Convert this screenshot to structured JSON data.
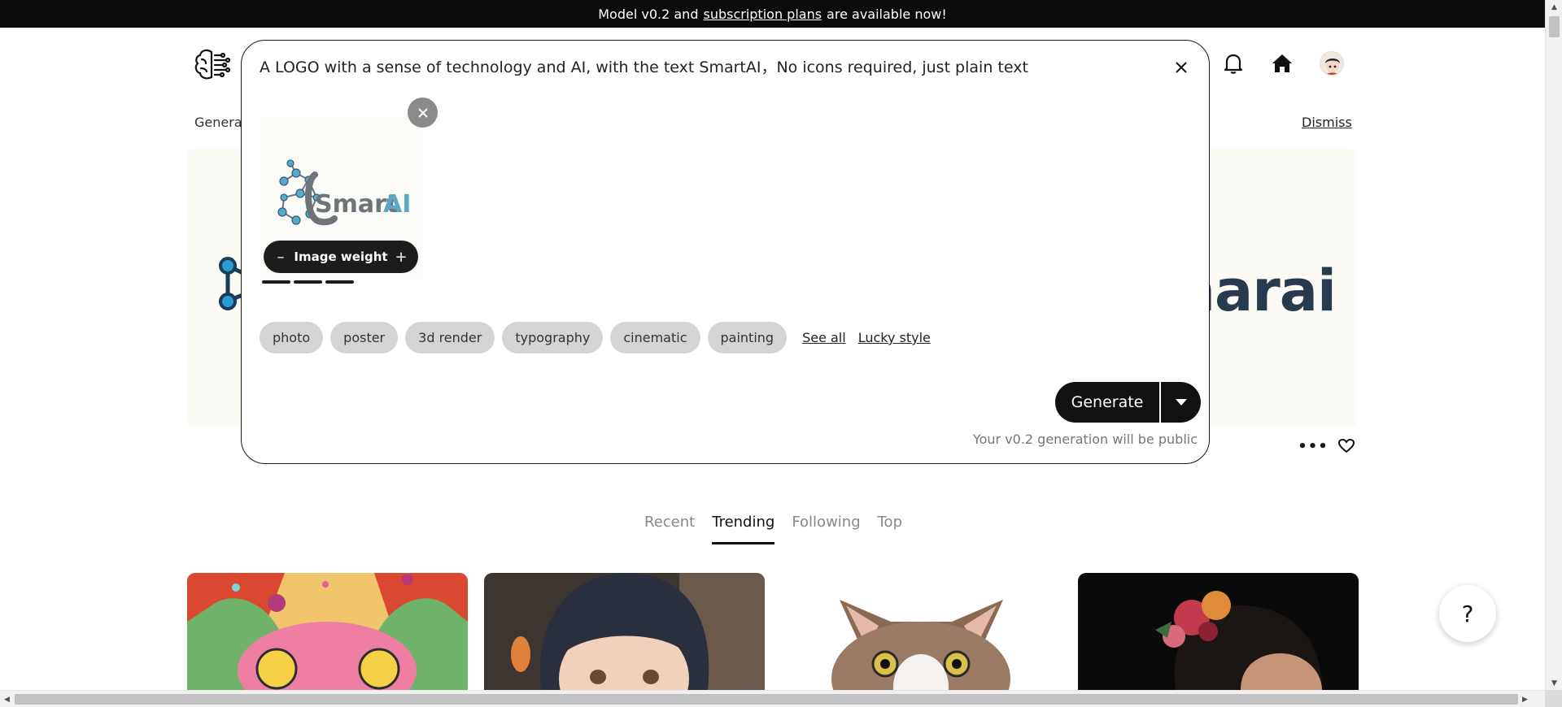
{
  "announcement": {
    "prefix": "Model v0.2 and",
    "link": "subscription plans",
    "suffix": "are available now!"
  },
  "header": {
    "logo_icon": "brain-icon",
    "notifications_icon": "bell-icon",
    "home_icon": "home-icon",
    "avatar_icon": "user-avatar"
  },
  "page": {
    "generate_label": "Genera",
    "dismiss_label": "Dismiss",
    "hero_text": "snarai"
  },
  "modal": {
    "prompt": "A LOGO with a sense of technology and AI, with the text SmartAI，No icons required, just plain text",
    "image_text": "SmartAI",
    "image_weight_label": "Image weight",
    "weight_level": 3,
    "chips": [
      "photo",
      "poster",
      "3d render",
      "typography",
      "cinematic",
      "painting"
    ],
    "see_all_label": "See all",
    "lucky_style_label": "Lucky style",
    "generate_label": "Generate",
    "public_note": "Your v0.2 generation will be public"
  },
  "tabs": [
    "Recent",
    "Trending",
    "Following",
    "Top"
  ],
  "active_tab": "Trending",
  "help_label": "?",
  "colors": {
    "accent": "#111111",
    "chip_bg": "#d4d4d4",
    "logo_blue": "#5aa9c9",
    "logo_gray": "#6f7479"
  }
}
